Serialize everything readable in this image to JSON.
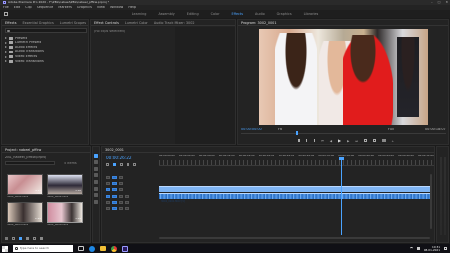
{
  "titlebar": {
    "title": "Adobe Premiere Pro 2020 - F:\\ZBL\\nabeel\\ZBL\\nabeel_pffkw.prproj *"
  },
  "menubar": [
    "File",
    "Edit",
    "Clip",
    "Sequence",
    "Markers",
    "Graphics",
    "View",
    "Window",
    "Help"
  ],
  "workspaces": {
    "tabs": [
      "Learning",
      "Assembly",
      "Editing",
      "Color",
      "Effects",
      "Audio",
      "Graphics",
      "Libraries"
    ],
    "active": "Editing"
  },
  "effects_panel": {
    "tabs": [
      "Effects",
      "Essential Graphics",
      "Lumetri Scopes"
    ],
    "folders": [
      "Presets",
      "Lumetri Presets",
      "Audio Effects",
      "Audio Transitions",
      "Video Effects",
      "Video Transitions"
    ]
  },
  "effect_controls": {
    "tabs": [
      "Effect Controls",
      "Lumetri Color",
      "Audio Track Mixer: 3002"
    ],
    "no_clip": "(no clips selected)"
  },
  "program_monitor": {
    "title": "Program: 3002_0001",
    "timecode_left": "00:00:00:00",
    "fit": "Fit",
    "quality": "Full",
    "timecode_right": "00:00:18:07"
  },
  "project_panel": {
    "title": "Project: nabeel_pffkw",
    "file": "ZBL_nabeel_pffkw.prproj",
    "items_count": "5 items",
    "thumbs": [
      {
        "label": "3002_0001.MOV",
        "duration": "4:13"
      },
      {
        "label": "3002_0002.MOV",
        "duration": "3:16"
      },
      {
        "label": "3002_0003.MOV",
        "duration": "2:22"
      },
      {
        "label": "3002_0004.MOV",
        "duration": "5:01"
      }
    ]
  },
  "timeline": {
    "title": "3002_0001",
    "timecode": "00:00:26:22",
    "ruler": [
      "00:00:00:00",
      "00:00:04:00",
      "00:00:08:00",
      "00:00:12:00",
      "00:00:16:00",
      "00:00:20:00",
      "00:00:24:00",
      "00:00:28:00",
      "00:00:32:00",
      "00:00:36:00",
      "00:00:40:00",
      "00:00:44:00",
      "00:00:48:00",
      "00:00:52:00"
    ],
    "tracks": [
      "V3",
      "V2",
      "V1",
      "A1",
      "A2",
      "A3"
    ],
    "clip_label": "3002_0001.MOV [V]"
  },
  "taskbar": {
    "search_placeholder": "Type here to search",
    "time": "10:31",
    "date": "08-01-2021"
  },
  "colors": {
    "accent": "#2b8cff",
    "clip_video": "#8ab7ee",
    "clip_audio": "#4a90e2",
    "bg": "#1b1b1b"
  }
}
